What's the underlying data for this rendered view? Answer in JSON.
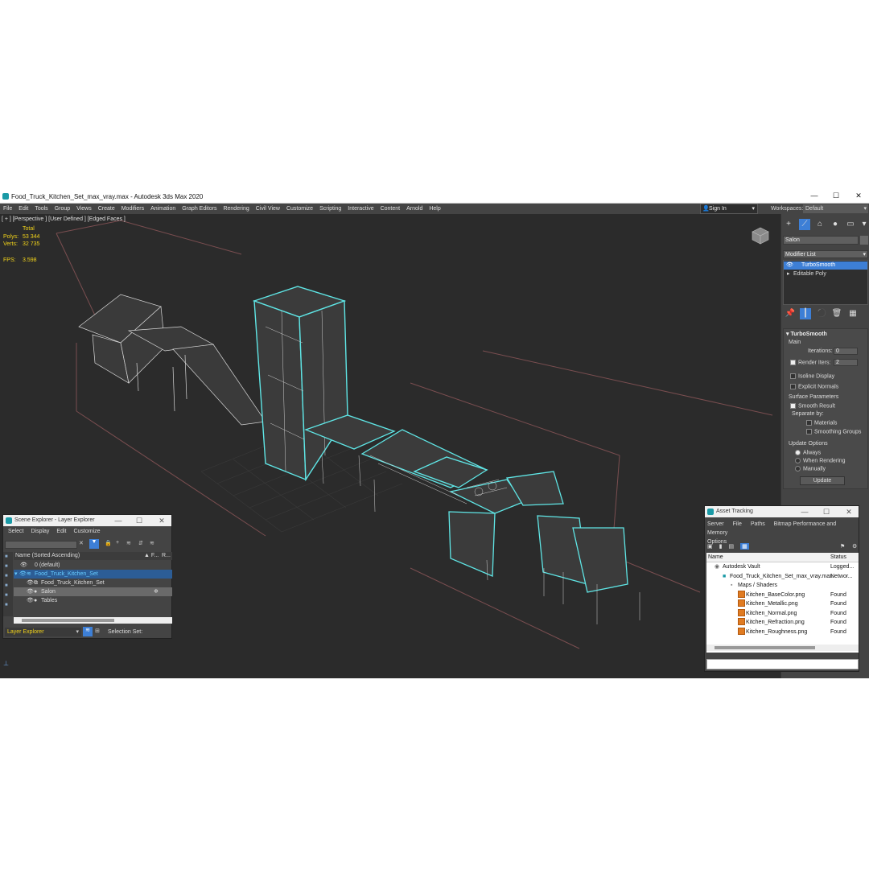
{
  "window": {
    "title": "Food_Truck_Kitchen_Set_max_vray.max - Autodesk 3ds Max 2020",
    "controls": [
      "—",
      "☐",
      "✕"
    ]
  },
  "menu": [
    "File",
    "Edit",
    "Tools",
    "Group",
    "Views",
    "Create",
    "Modifiers",
    "Animation",
    "Graph Editors",
    "Rendering",
    "Civil View",
    "Customize",
    "Scripting",
    "Interactive",
    "Content",
    "Arnold",
    "Help"
  ],
  "signin": {
    "label": "Sign In"
  },
  "workspaces": {
    "label": "Workspaces:",
    "value": "Default"
  },
  "viewport": {
    "label": "[ + ] [Perspective ] [User Defined ] [Edged Faces ]",
    "stats": {
      "total_label": "Total",
      "polys_label": "Polys:",
      "polys": "53 344",
      "verts_label": "Verts:",
      "verts": "32 735",
      "fps_label": "FPS:",
      "fps": "3.598"
    }
  },
  "command_panel": {
    "object_name": "Salon",
    "modifier_list_label": "Modifier List",
    "stack": [
      "TurboSmooth",
      "Editable Poly"
    ],
    "rollout_title": "TurboSmooth",
    "main_label": "Main",
    "iterations_label": "Iterations:",
    "iterations_value": "0",
    "render_iters_label": "Render Iters:",
    "render_iters_value": "2",
    "isoline_label": "Isoline Display",
    "explicit_normals_label": "Explicit Normals",
    "surface_params_label": "Surface Parameters",
    "smooth_result_label": "Smooth Result",
    "separate_by_label": "Separate by:",
    "materials_label": "Materials",
    "smoothing_groups_label": "Smoothing Groups",
    "update_options_label": "Update Options",
    "always_label": "Always",
    "when_rendering_label": "When Rendering",
    "manually_label": "Manually",
    "update_button": "Update"
  },
  "scene_explorer": {
    "title": "Scene Explorer - Layer Explorer",
    "menu": [
      "Select",
      "Display",
      "Edit",
      "Customize"
    ],
    "col_name": "Name (Sorted Ascending)",
    "col_f": "▲ F...",
    "col_r": "R...",
    "rows": [
      "0 (default)",
      "Food_Truck_Kitchen_Set",
      "Food_Truck_Kitchen_Set",
      "Salon",
      "Tables"
    ],
    "footer_label": "Layer Explorer",
    "selection_set_label": "Selection Set:"
  },
  "asset_tracking": {
    "title": "Asset Tracking",
    "menu": [
      "Server",
      "File",
      "Paths",
      "Bitmap Performance and Memory",
      "Options"
    ],
    "col_name": "Name",
    "col_status": "Status",
    "rows": [
      {
        "name": "Autodesk Vault",
        "status": "Logged..."
      },
      {
        "name": "Food_Truck_Kitchen_Set_max_vray.max",
        "status": "Networ..."
      },
      {
        "name": "Maps / Shaders",
        "status": ""
      },
      {
        "name": "Kitchen_BaseColor.png",
        "status": "Found"
      },
      {
        "name": "Kitchen_Metallic.png",
        "status": "Found"
      },
      {
        "name": "Kitchen_Normal.png",
        "status": "Found"
      },
      {
        "name": "Kitchen_Refraction.png",
        "status": "Found"
      },
      {
        "name": "Kitchen_Roughness.png",
        "status": "Found"
      }
    ]
  },
  "colors": {
    "viewport_bg": "#2b2b2b",
    "panel_bg": "#444444",
    "stats_yellow": "#f2d31a",
    "selection_cyan": "#5fe6e6",
    "highlight_blue": "#3d7fd6"
  }
}
